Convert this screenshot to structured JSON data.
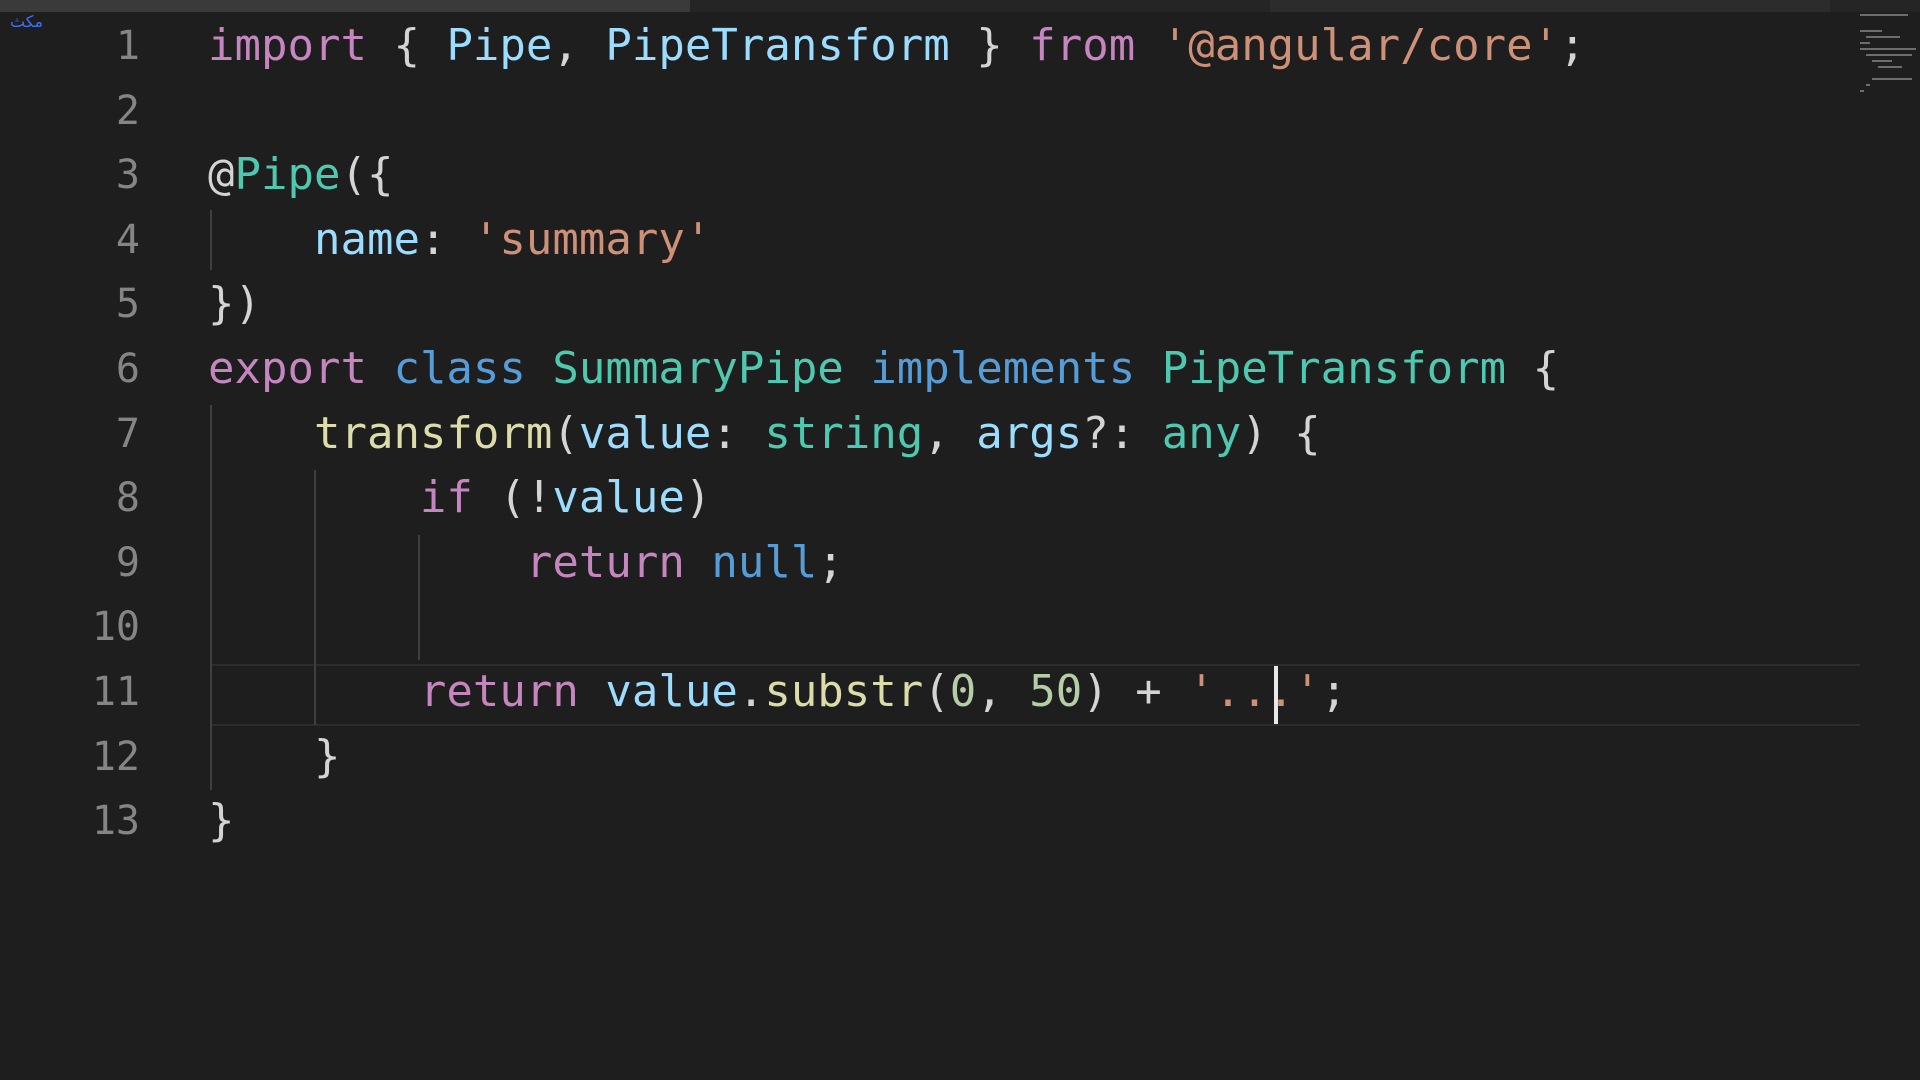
{
  "editor": {
    "watermark": "مكث",
    "line_numbers": [
      "1",
      "2",
      "3",
      "4",
      "5",
      "6",
      "7",
      "8",
      "9",
      "10",
      "11",
      "12",
      "13"
    ],
    "lines": [
      [
        {
          "t": "import",
          "c": "kw-ctrl"
        },
        {
          "t": " { ",
          "c": "punc"
        },
        {
          "t": "Pipe",
          "c": "var"
        },
        {
          "t": ", ",
          "c": "punc"
        },
        {
          "t": "PipeTransform",
          "c": "var"
        },
        {
          "t": " } ",
          "c": "punc"
        },
        {
          "t": "from",
          "c": "kw-ctrl"
        },
        {
          "t": " ",
          "c": "punc"
        },
        {
          "t": "'@angular/core'",
          "c": "str"
        },
        {
          "t": ";",
          "c": "punc"
        }
      ],
      [],
      [
        {
          "t": "@",
          "c": "punc"
        },
        {
          "t": "Pipe",
          "c": "type"
        },
        {
          "t": "({",
          "c": "punc"
        }
      ],
      [
        {
          "t": "    ",
          "c": "punc"
        },
        {
          "t": "name",
          "c": "var"
        },
        {
          "t": ": ",
          "c": "punc"
        },
        {
          "t": "'summary'",
          "c": "str"
        }
      ],
      [
        {
          "t": "})",
          "c": "punc"
        }
      ],
      [
        {
          "t": "export",
          "c": "kw-ctrl"
        },
        {
          "t": " ",
          "c": "punc"
        },
        {
          "t": "class",
          "c": "kw"
        },
        {
          "t": " ",
          "c": "punc"
        },
        {
          "t": "SummaryPipe",
          "c": "type"
        },
        {
          "t": " ",
          "c": "punc"
        },
        {
          "t": "implements",
          "c": "kw"
        },
        {
          "t": " ",
          "c": "punc"
        },
        {
          "t": "PipeTransform",
          "c": "type"
        },
        {
          "t": " {",
          "c": "punc"
        }
      ],
      [
        {
          "t": "    ",
          "c": "punc"
        },
        {
          "t": "transform",
          "c": "fn"
        },
        {
          "t": "(",
          "c": "punc"
        },
        {
          "t": "value",
          "c": "var"
        },
        {
          "t": ": ",
          "c": "punc"
        },
        {
          "t": "string",
          "c": "type"
        },
        {
          "t": ", ",
          "c": "punc"
        },
        {
          "t": "args",
          "c": "var"
        },
        {
          "t": "?: ",
          "c": "punc"
        },
        {
          "t": "any",
          "c": "type"
        },
        {
          "t": ") {",
          "c": "punc"
        }
      ],
      [
        {
          "t": "        ",
          "c": "punc"
        },
        {
          "t": "if",
          "c": "kw-ctrl"
        },
        {
          "t": " (!",
          "c": "punc"
        },
        {
          "t": "value",
          "c": "var"
        },
        {
          "t": ")",
          "c": "punc"
        }
      ],
      [
        {
          "t": "            ",
          "c": "punc"
        },
        {
          "t": "return",
          "c": "kw-ctrl"
        },
        {
          "t": " ",
          "c": "punc"
        },
        {
          "t": "null",
          "c": "kw"
        },
        {
          "t": ";",
          "c": "punc"
        }
      ],
      [],
      [
        {
          "t": "        ",
          "c": "punc"
        },
        {
          "t": "return",
          "c": "kw-ctrl"
        },
        {
          "t": " ",
          "c": "punc"
        },
        {
          "t": "value",
          "c": "var"
        },
        {
          "t": ".",
          "c": "punc"
        },
        {
          "t": "substr",
          "c": "fn"
        },
        {
          "t": "(",
          "c": "punc"
        },
        {
          "t": "0",
          "c": "num"
        },
        {
          "t": ", ",
          "c": "punc"
        },
        {
          "t": "50",
          "c": "num"
        },
        {
          "t": ") + ",
          "c": "punc"
        },
        {
          "t": "'...'",
          "c": "str"
        },
        {
          "t": ";",
          "c": "punc"
        }
      ],
      [
        {
          "t": "    }",
          "c": "punc"
        }
      ],
      [
        {
          "t": "}",
          "c": "punc"
        }
      ]
    ],
    "colors": {
      "background": "#1e1e1e",
      "keyword_control": "#c586c0",
      "keyword": "#569cd6",
      "type": "#4ec9b0",
      "variable": "#9cdcfe",
      "function": "#dcdcaa",
      "string": "#ce9178",
      "number": "#b5cea8",
      "line_number": "#858585"
    }
  }
}
